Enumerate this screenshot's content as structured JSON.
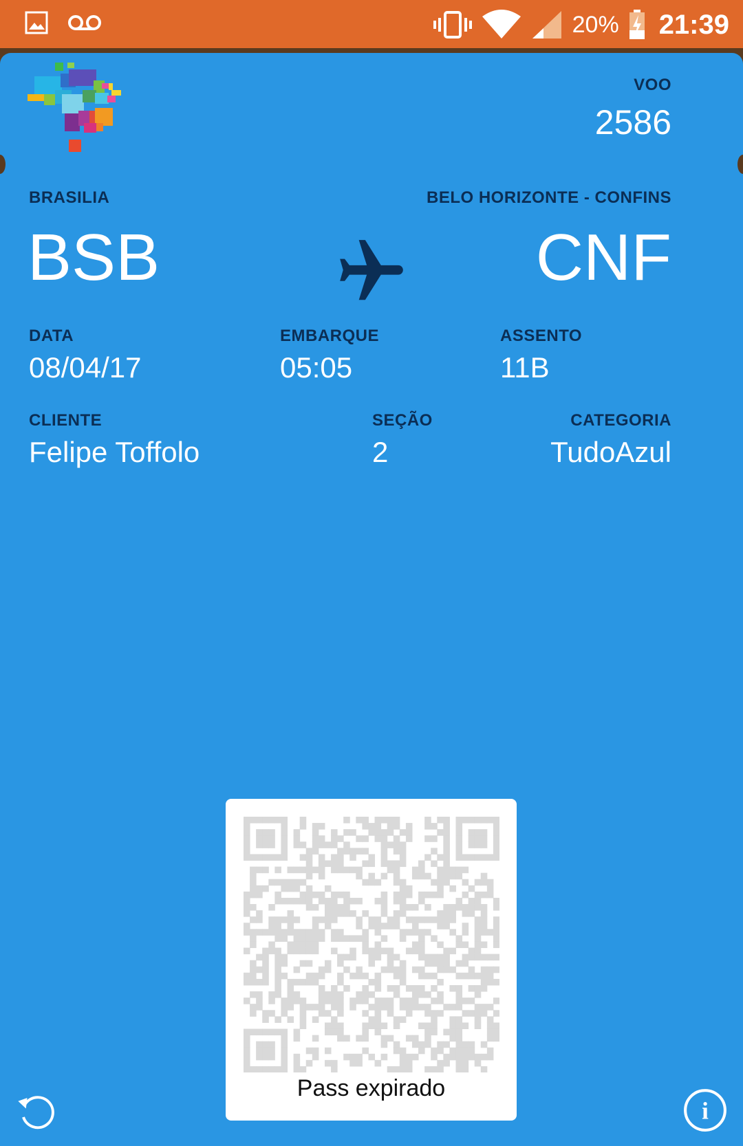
{
  "status_bar": {
    "battery_percent": "20%",
    "time": "21:39",
    "icons": [
      "image-icon",
      "voicemail-icon",
      "vibrate-icon",
      "wifi-icon",
      "signal-icon",
      "battery-charging-icon"
    ]
  },
  "pass": {
    "background": "#2a96e3",
    "label_color": "#0b2e55",
    "flight": {
      "label": "VOO",
      "value": "2586"
    },
    "origin": {
      "city": "BRASILIA",
      "code": "BSB"
    },
    "destination": {
      "city": "BELO HORIZONTE - CONFINS",
      "code": "CNF"
    },
    "fields_row1": [
      {
        "label": "DATA",
        "value": "08/04/17"
      },
      {
        "label": "EMBARQUE",
        "value": "05:05"
      },
      {
        "label": "ASSENTO",
        "value": "11B"
      }
    ],
    "fields_row2": [
      {
        "label": "CLIENTE",
        "value": "Felipe Toffolo"
      },
      {
        "label": "SEÇÃO",
        "value": "2"
      },
      {
        "label": "CATEGORIA",
        "value": "TudoAzul"
      }
    ],
    "barcode_caption": "Pass expirado"
  }
}
